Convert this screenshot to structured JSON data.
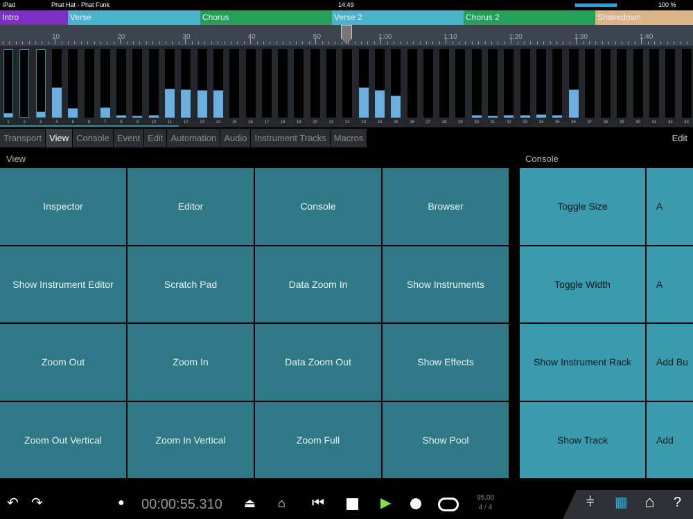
{
  "status": {
    "device": "iPad",
    "doc": "Phat Hat - Phat Funk",
    "time": "14:49",
    "battery": "100 %"
  },
  "sections": [
    {
      "label": "Intro",
      "color": "#7b2fc4"
    },
    {
      "label": "Verse",
      "color": "#4ab3cb"
    },
    {
      "label": "Chorus",
      "color": "#23a058"
    },
    {
      "label": "Verse 2",
      "color": "#4ab3cb"
    },
    {
      "label": "Chorus 2",
      "color": "#23a058"
    },
    {
      "label": "Shakedown",
      "color": "#dcb385"
    }
  ],
  "ruler_labels": [
    "10",
    "20",
    "30",
    "40",
    "50",
    "1:00",
    "1:10",
    "1:20",
    "1:30",
    "1:40"
  ],
  "channels": {
    "levels": [
      0.06,
      0,
      0.08,
      0.44,
      0.14,
      0,
      0.15,
      0.04,
      0.03,
      0.04,
      0.42,
      0.41,
      0.4,
      0.4,
      0,
      0,
      0,
      0,
      0,
      0,
      0,
      0,
      0.44,
      0.4,
      0.32,
      0,
      0,
      0,
      0,
      0.04,
      0.03,
      0.04,
      0.04,
      0.05,
      0.04,
      0.41,
      0,
      0,
      0,
      0,
      0,
      0,
      0
    ],
    "selected": [
      1,
      2,
      3
    ]
  },
  "tabs": [
    "Transport",
    "View",
    "Console",
    "Event",
    "Edit",
    "Automation",
    "Audio",
    "Instrument Tracks",
    "Macros"
  ],
  "active_tab": "View",
  "edit_label": "Edit",
  "view": {
    "title": "View",
    "buttons": [
      "Inspector",
      "Editor",
      "Console",
      "Browser",
      "Show Instrument Editor",
      "Scratch Pad",
      "Data Zoom In",
      "Show Instruments",
      "Zoom Out",
      "Zoom In",
      "Data Zoom Out",
      "Show Effects",
      "Zoom Out Vertical",
      "Zoom In Vertical",
      "Zoom Full",
      "Show Pool"
    ]
  },
  "console": {
    "title": "Console",
    "buttons": [
      "Toggle Size",
      "A",
      "Toggle Width",
      "A",
      "Show Instrument Rack",
      "Add Bu",
      "Show Track",
      "Add"
    ]
  },
  "transport": {
    "time": "00:00:55.310",
    "tempo": "95.00",
    "signature": "4 / 4"
  }
}
